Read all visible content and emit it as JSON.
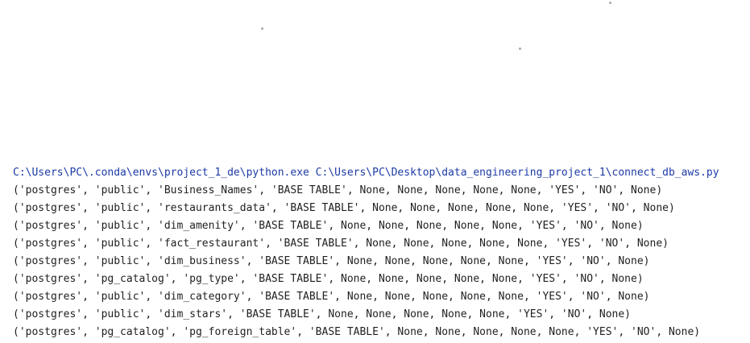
{
  "console": {
    "command": "C:\\Users\\PC\\.conda\\envs\\project_1_de\\python.exe C:\\Users\\PC\\Desktop\\data_engineering_project_1\\connect_db_aws.py",
    "lines": [
      "('postgres', 'public', 'Business_Names', 'BASE TABLE', None, None, None, None, None, 'YES', 'NO', None)",
      "('postgres', 'public', 'restaurants_data', 'BASE TABLE', None, None, None, None, None, 'YES', 'NO', None)",
      "('postgres', 'public', 'dim_amenity', 'BASE TABLE', None, None, None, None, None, 'YES', 'NO', None)",
      "('postgres', 'public', 'fact_restaurant', 'BASE TABLE', None, None, None, None, None, 'YES', 'NO', None)",
      "('postgres', 'public', 'dim_business', 'BASE TABLE', None, None, None, None, None, 'YES', 'NO', None)",
      "('postgres', 'pg_catalog', 'pg_type', 'BASE TABLE', None, None, None, None, None, 'YES', 'NO', None)",
      "('postgres', 'public', 'dim_category', 'BASE TABLE', None, None, None, None, None, 'YES', 'NO', None)",
      "('postgres', 'public', 'dim_stars', 'BASE TABLE', None, None, None, None, None, 'YES', 'NO', None)",
      "('postgres', 'pg_catalog', 'pg_foreign_table', 'BASE TABLE', None, None, None, None, None, 'YES', 'NO', None)"
    ]
  },
  "colors": {
    "background": "#ffffff",
    "command": "#1c3aa6",
    "output": "#1f1f1f"
  }
}
